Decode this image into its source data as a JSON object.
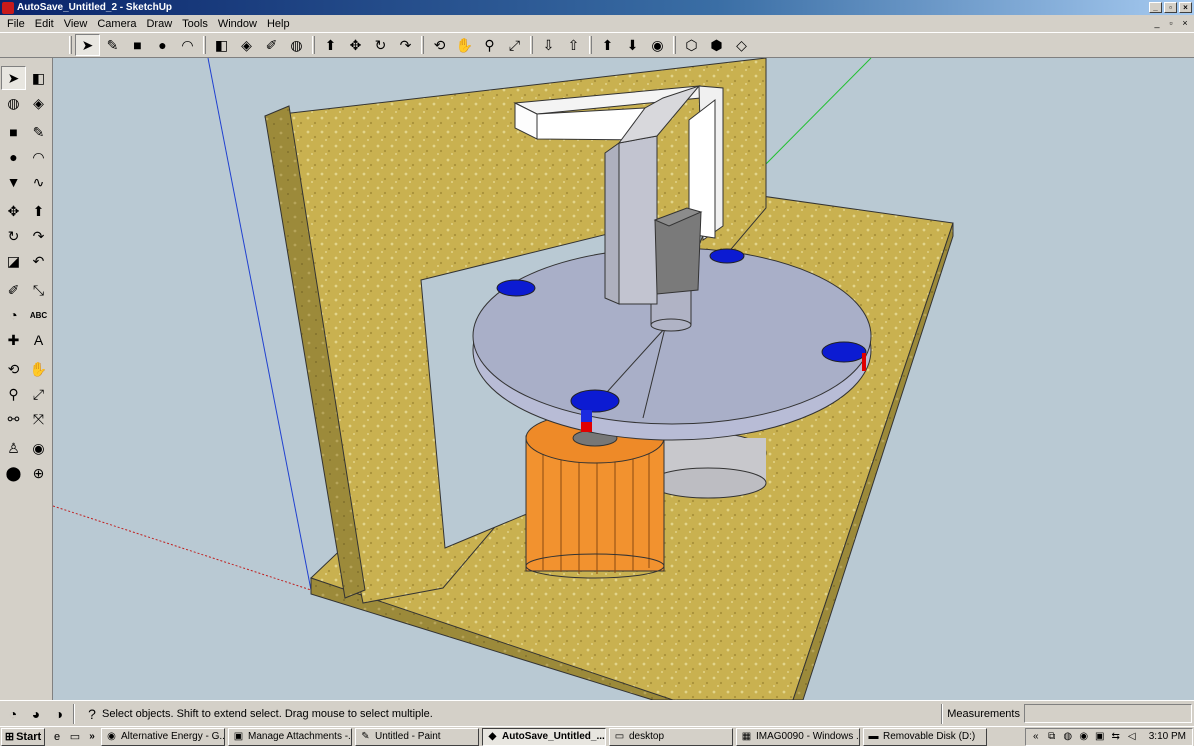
{
  "window": {
    "title": "AutoSave_Untitled_2 - SketchUp",
    "minimize": "_",
    "maximize": "▫",
    "close": "×"
  },
  "menu": {
    "items": [
      "File",
      "Edit",
      "View",
      "Camera",
      "Draw",
      "Tools",
      "Window",
      "Help"
    ],
    "mdi": [
      "_",
      "▫",
      "×"
    ]
  },
  "toolbar": {
    "groups": [
      [
        {
          "icon": "select-icon",
          "glyph": "➤",
          "active": true
        },
        {
          "icon": "pencil-icon",
          "glyph": "✎"
        },
        {
          "icon": "rectangle-icon",
          "glyph": "■"
        },
        {
          "icon": "circle-icon",
          "glyph": "●"
        },
        {
          "icon": "arc-icon",
          "glyph": "◠"
        }
      ],
      [
        {
          "icon": "make-component-icon",
          "glyph": "◧"
        },
        {
          "icon": "eraser-icon",
          "glyph": "◈"
        },
        {
          "icon": "tape-measure-icon",
          "glyph": "✐"
        },
        {
          "icon": "paint-bucket-icon",
          "glyph": "◍"
        }
      ],
      [
        {
          "icon": "push-pull-icon",
          "glyph": "⬆"
        },
        {
          "icon": "move-icon",
          "glyph": "✥"
        },
        {
          "icon": "rotate-icon",
          "glyph": "↻"
        },
        {
          "icon": "follow-me-icon",
          "glyph": "↷"
        }
      ],
      [
        {
          "icon": "orbit-icon",
          "glyph": "⟲"
        },
        {
          "icon": "pan-icon",
          "glyph": "✋"
        },
        {
          "icon": "zoom-icon",
          "glyph": "⚲"
        },
        {
          "icon": "zoom-extents-icon",
          "glyph": "⤢"
        }
      ],
      [
        {
          "icon": "get-models-icon",
          "glyph": "⇩"
        },
        {
          "icon": "share-model-icon",
          "glyph": "⇧"
        }
      ],
      [
        {
          "icon": "share-component-icon",
          "glyph": "⬆"
        },
        {
          "icon": "get-photo-texture-icon",
          "glyph": "⬇"
        },
        {
          "icon": "geo-location-icon",
          "glyph": "◉"
        }
      ],
      [
        {
          "icon": "component-options-icon",
          "glyph": "⬡"
        },
        {
          "icon": "components-icon",
          "glyph": "⬢"
        },
        {
          "icon": "extension-icon",
          "glyph": "◇"
        }
      ]
    ]
  },
  "side_toolbar": {
    "rows": [
      [
        "select-icon",
        "make-component-icon"
      ],
      [
        "paint-bucket-icon",
        "eraser-icon"
      ],
      "gap",
      [
        "rectangle-icon",
        "line-icon"
      ],
      [
        "circle-icon",
        "arc-icon"
      ],
      [
        "polygon-icon",
        "freehand-icon"
      ],
      "gap",
      [
        "move-icon",
        "push-pull-icon"
      ],
      [
        "rotate-icon",
        "follow-me-icon"
      ],
      [
        "scale-icon",
        "offset-icon"
      ],
      "gap",
      [
        "tape-measure-icon",
        "dimension-icon"
      ],
      [
        "protractor-icon",
        "text-icon"
      ],
      [
        "axes-icon",
        "3d-text-icon"
      ],
      "gap",
      [
        "orbit-icon",
        "pan-icon"
      ],
      [
        "zoom-icon",
        "zoom-window-icon"
      ],
      [
        "previous-view-icon",
        "zoom-extents-icon"
      ],
      "gap",
      [
        "position-camera-icon",
        "look-around-icon"
      ],
      [
        "walk-icon",
        "section-plane-icon"
      ]
    ],
    "glyphs": {
      "select-icon": "➤",
      "make-component-icon": "◧",
      "paint-bucket-icon": "◍",
      "eraser-icon": "◈",
      "rectangle-icon": "■",
      "line-icon": "✎",
      "circle-icon": "●",
      "arc-icon": "◠",
      "polygon-icon": "▼",
      "freehand-icon": "∿",
      "move-icon": "✥",
      "push-pull-icon": "⬆",
      "rotate-icon": "↻",
      "follow-me-icon": "↷",
      "scale-icon": "◪",
      "offset-icon": "↶",
      "tape-measure-icon": "✐",
      "dimension-icon": "⤡",
      "protractor-icon": "◔",
      "text-icon": "ABC",
      "axes-icon": "✚",
      "3d-text-icon": "A",
      "orbit-icon": "⟲",
      "pan-icon": "✋",
      "zoom-icon": "⚲",
      "zoom-window-icon": "⤢",
      "previous-view-icon": "⚯",
      "zoom-extents-icon": "⤧",
      "position-camera-icon": "♙",
      "look-around-icon": "◉",
      "walk-icon": "⬤",
      "section-plane-icon": "⊕"
    }
  },
  "status": {
    "text": "Select objects. Shift to extend select. Drag mouse to select multiple.",
    "measurements_label": "Measurements",
    "measurements_value": ""
  },
  "taskbar": {
    "start": "Start",
    "chevron": "»",
    "tasks": [
      {
        "label": "Alternative Energy - G...",
        "icon": "chrome-icon",
        "glyph": "◉",
        "width": 124
      },
      {
        "label": "Manage Attachments -...",
        "icon": "attachments-icon",
        "glyph": "▣",
        "width": 124
      },
      {
        "label": "Untitled - Paint",
        "icon": "paint-icon",
        "glyph": "✎",
        "width": 124
      },
      {
        "label": "AutoSave_Untitled_...",
        "icon": "sketchup-icon",
        "glyph": "◆",
        "width": 124,
        "active": true
      },
      {
        "label": "desktop",
        "icon": "folder-icon",
        "glyph": "▭",
        "width": 124
      },
      {
        "label": "IMAG0090 - Windows ...",
        "icon": "image-viewer-icon",
        "glyph": "▦",
        "width": 124
      },
      {
        "label": "Removable Disk (D:)",
        "icon": "drive-icon",
        "glyph": "▬",
        "width": 124
      }
    ],
    "tray_chevron": "«",
    "clock": "3:10 PM"
  },
  "colors": {
    "sky": "#b9c9d3",
    "wood": "#c9b150",
    "table": "#a9afc8",
    "marker": "#0c1bd2",
    "motor": "#f2922f",
    "red": "#e00000"
  }
}
